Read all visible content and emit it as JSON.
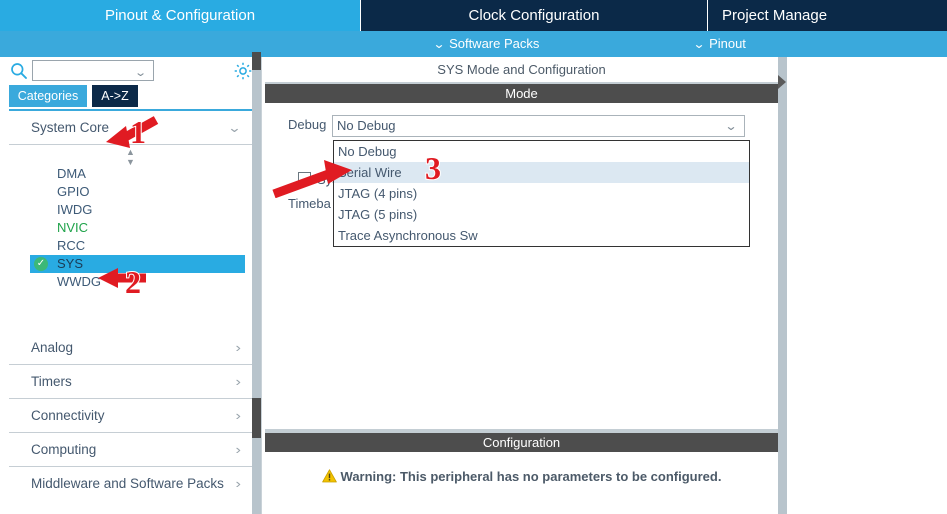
{
  "top_tabs": [
    {
      "id": "pinout-configuration",
      "label": "Pinout & Configuration",
      "active": true
    },
    {
      "id": "clock-configuration",
      "label": "Clock Configuration",
      "active": false
    },
    {
      "id": "project-manager",
      "label": "Project Manage",
      "active": false
    }
  ],
  "sub_bar": {
    "software_packs": "Software Packs",
    "pinout": "Pinout",
    "chevron": "⌄"
  },
  "sidebar": {
    "search": {
      "value": "",
      "placeholder": ""
    },
    "tabs": {
      "categories": "Categories",
      "az": "A->Z"
    },
    "groups": [
      {
        "id": "system-core",
        "label": "System Core",
        "expanded": true,
        "items": [
          {
            "label": "DMA",
            "state": "normal"
          },
          {
            "label": "GPIO",
            "state": "normal"
          },
          {
            "label": "IWDG",
            "state": "normal"
          },
          {
            "label": "NVIC",
            "state": "configured"
          },
          {
            "label": "RCC",
            "state": "normal"
          },
          {
            "label": "SYS",
            "state": "selected"
          },
          {
            "label": "WWDG",
            "state": "normal"
          }
        ]
      },
      {
        "id": "analog",
        "label": "Analog",
        "expanded": false,
        "items": []
      },
      {
        "id": "timers",
        "label": "Timers",
        "expanded": false,
        "items": []
      },
      {
        "id": "connectivity",
        "label": "Connectivity",
        "expanded": false,
        "items": []
      },
      {
        "id": "computing",
        "label": "Computing",
        "expanded": false,
        "items": []
      },
      {
        "id": "middleware",
        "label": "Middleware and Software Packs",
        "expanded": false,
        "items": []
      }
    ]
  },
  "main": {
    "panel_title": "SYS Mode and Configuration",
    "mode_header": "Mode",
    "debug_label": "Debug",
    "debug_value": "No Debug",
    "sys_checkbox_label": "Sys",
    "sys_checkbox_checked": false,
    "timebase_label": "Timeba",
    "dropdown_options": [
      {
        "label": "No Debug",
        "hovered": false
      },
      {
        "label": "Serial Wire",
        "hovered": true
      },
      {
        "label": "JTAG (4 pins)",
        "hovered": false
      },
      {
        "label": "JTAG (5 pins)",
        "hovered": false
      },
      {
        "label": "Trace Asynchronous Sw",
        "hovered": false
      }
    ],
    "config_header": "Configuration",
    "config_warning": "Warning: This peripheral has no parameters to be configured."
  },
  "annotations": [
    {
      "id": "1",
      "label": "1",
      "target": "System Core group header"
    },
    {
      "id": "2",
      "label": "2",
      "target": "SYS list item"
    },
    {
      "id": "3",
      "label": "3",
      "target": "Serial Wire dropdown option"
    }
  ],
  "colors": {
    "tab_active": "#29abe2",
    "tab_bar": "#0b2948",
    "sub_bar": "#3aa9dc",
    "section_header": "#4d4d4d",
    "selection": "#29abe2",
    "configured_green": "#1fa34a",
    "check_badge": "#3cb878",
    "warning_yellow": "#f2c200",
    "annotation_red": "#e01b22",
    "dropdown_hover": "#dce8f2"
  }
}
